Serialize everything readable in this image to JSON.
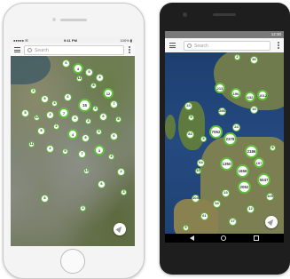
{
  "iphone": {
    "status": {
      "carrier": "●●●●● ✉",
      "time": "9:11 PM",
      "battery": "100% ▮"
    },
    "search_placeholder": "Search",
    "clusters": [
      {
        "label": "6"
      },
      {
        "label": "4"
      },
      {
        "label": "5"
      },
      {
        "label": "11"
      },
      {
        "label": "3"
      },
      {
        "label": "8"
      },
      {
        "label": "12"
      },
      {
        "label": "7"
      },
      {
        "label": "2"
      },
      {
        "label": "9"
      },
      {
        "label": "4"
      },
      {
        "label": "6"
      },
      {
        "label": "15"
      },
      {
        "label": "3"
      },
      {
        "label": "5"
      },
      {
        "label": "10"
      },
      {
        "label": "2"
      },
      {
        "label": "7"
      },
      {
        "label": "4"
      },
      {
        "label": "3"
      },
      {
        "label": "6"
      },
      {
        "label": "8"
      },
      {
        "label": "5"
      },
      {
        "label": "2"
      },
      {
        "label": "4"
      },
      {
        "label": "9"
      },
      {
        "label": "3"
      },
      {
        "label": "6"
      },
      {
        "label": "11"
      },
      {
        "label": "2"
      },
      {
        "label": "5"
      },
      {
        "label": "7"
      },
      {
        "label": "3"
      },
      {
        "label": "4"
      },
      {
        "label": "2"
      },
      {
        "label": "13"
      },
      {
        "label": "6"
      },
      {
        "label": "3"
      },
      {
        "label": "8"
      },
      {
        "label": "2"
      }
    ]
  },
  "pixel": {
    "status_time": "12:30",
    "search_placeholder": "Search",
    "clusters": [
      {
        "label": "2"
      },
      {
        "label": "36"
      },
      {
        "label": "213"
      },
      {
        "label": "196"
      },
      {
        "label": "632"
      },
      {
        "label": "1012"
      },
      {
        "label": "16"
      },
      {
        "label": "23"
      },
      {
        "label": "286"
      },
      {
        "label": "9"
      },
      {
        "label": "83"
      },
      {
        "label": "7062"
      },
      {
        "label": "2378"
      },
      {
        "label": "4"
      },
      {
        "label": "24"
      },
      {
        "label": "64"
      },
      {
        "label": "1350"
      },
      {
        "label": "1656"
      },
      {
        "label": "107"
      },
      {
        "label": "2052"
      },
      {
        "label": "16"
      },
      {
        "label": "2186"
      },
      {
        "label": "5047"
      },
      {
        "label": "23"
      },
      {
        "label": "105"
      },
      {
        "label": "1040"
      },
      {
        "label": "34"
      },
      {
        "label": "8"
      },
      {
        "label": "61"
      },
      {
        "label": "17"
      },
      {
        "label": "12"
      },
      {
        "label": "5"
      }
    ]
  }
}
